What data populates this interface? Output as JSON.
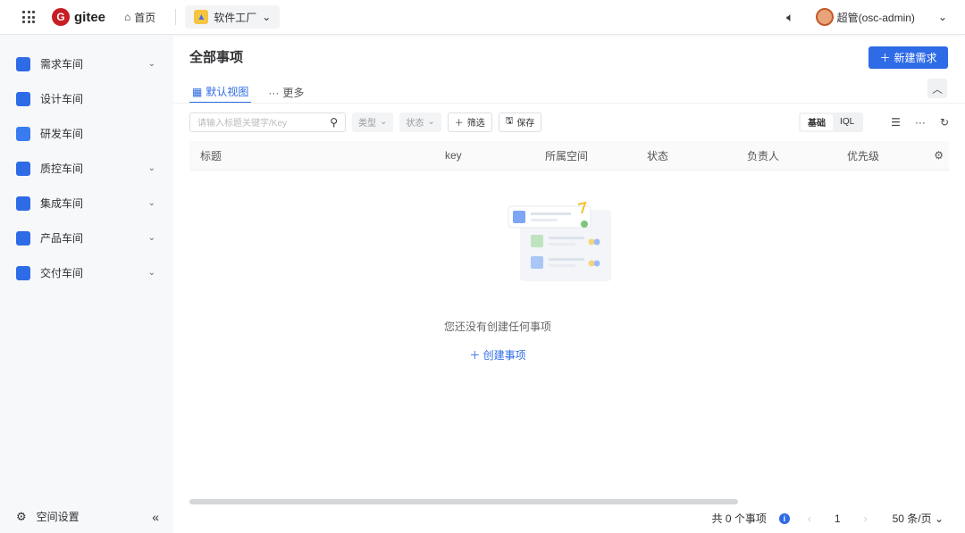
{
  "topbar": {
    "brand": "gitee",
    "home": "首页",
    "project": "软件工厂",
    "user": "超管(osc-admin)"
  },
  "sidebar": {
    "items": [
      {
        "label": "需求车间",
        "color": "#2e6be6",
        "chevron": true
      },
      {
        "label": "设计车间",
        "color": "#2e6be6",
        "chevron": false
      },
      {
        "label": "研发车间",
        "color": "#3a7cf0",
        "chevron": false
      },
      {
        "label": "质控车间",
        "color": "#2e6be6",
        "chevron": true
      },
      {
        "label": "集成车间",
        "color": "#2e6be6",
        "chevron": true
      },
      {
        "label": "产品车间",
        "color": "#2e6be6",
        "chevron": true
      },
      {
        "label": "交付车间",
        "color": "#2e6be6",
        "chevron": true
      }
    ],
    "settings": "空间设置"
  },
  "main": {
    "title": "全部事项",
    "new_button": "新建需求",
    "tabs": [
      "默认视图",
      "更多"
    ],
    "search_placeholder": "请输入标题关键字/Key",
    "type_filter": "类型",
    "status_filter": "状态",
    "filter_button": "筛选",
    "save_button": "保存",
    "mode_basic": "基础",
    "mode_iql": "IQL",
    "columns": [
      "标题",
      "key",
      "所属空间",
      "状态",
      "负责人",
      "优先级"
    ],
    "empty_text": "您还没有创建任何事项",
    "create_link": "创建事项"
  },
  "footer": {
    "total": "共 0 个事项",
    "page": "1",
    "page_size": "50 条/页"
  }
}
